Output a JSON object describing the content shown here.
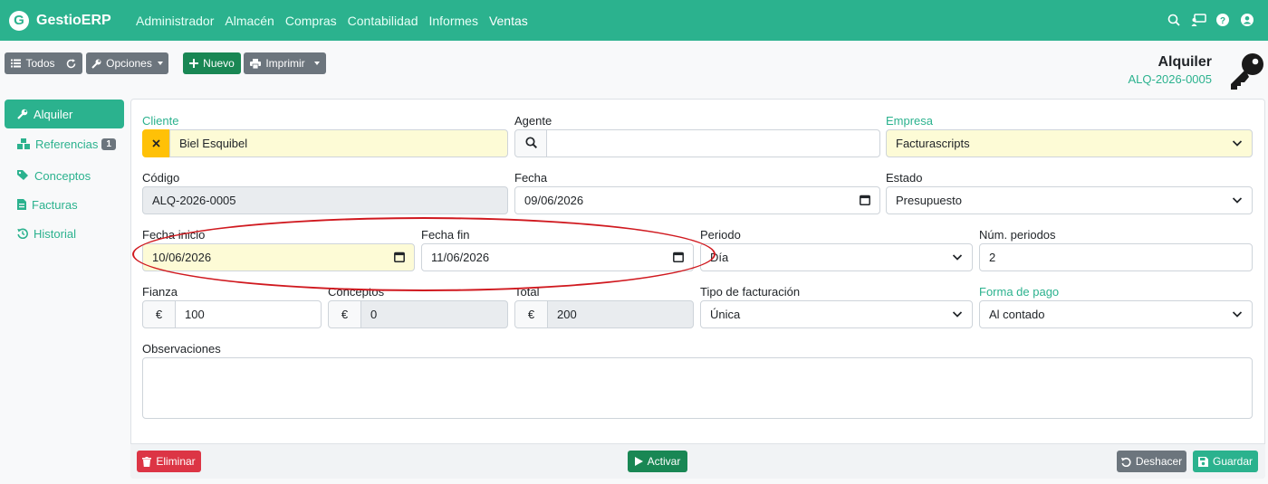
{
  "navbar": {
    "brand_letter": "G",
    "brand_name": "GestioERP",
    "menu": [
      "Administrador",
      "Almacén",
      "Compras",
      "Contabilidad",
      "Informes",
      "Ventas"
    ],
    "active": "Ventas"
  },
  "toolbar": {
    "all_label": "Todos",
    "options_label": "Opciones",
    "new_label": "Nuevo",
    "print_label": "Imprimir"
  },
  "header": {
    "title": "Alquiler",
    "code": "ALQ-2026-0005"
  },
  "sidebar": {
    "items": [
      {
        "label": "Alquiler",
        "icon": "wrench-icon",
        "active": true
      },
      {
        "label": "Referencias",
        "icon": "cubes-icon",
        "badge": "1"
      },
      {
        "label": "Conceptos",
        "icon": "tags-icon"
      },
      {
        "label": "Facturas",
        "icon": "file-invoice-icon"
      },
      {
        "label": "Historial",
        "icon": "history-icon"
      }
    ]
  },
  "form": {
    "cliente": {
      "label": "Cliente",
      "value": "Biel Esquibel"
    },
    "agente": {
      "label": "Agente",
      "value": ""
    },
    "empresa": {
      "label": "Empresa",
      "value": "Facturascripts"
    },
    "codigo": {
      "label": "Código",
      "value": "ALQ-2026-0005"
    },
    "fecha": {
      "label": "Fecha",
      "value": "09/06/2026"
    },
    "estado": {
      "label": "Estado",
      "value": "Presupuesto"
    },
    "fecha_inicio": {
      "label": "Fecha inicio",
      "value": "10/06/2026"
    },
    "fecha_fin": {
      "label": "Fecha fin",
      "value": "11/06/2026"
    },
    "periodo": {
      "label": "Periodo",
      "value": "Día"
    },
    "num_periodos": {
      "label": "Núm. periodos",
      "value": "2"
    },
    "fianza": {
      "label": "Fianza",
      "value": "100"
    },
    "conceptos": {
      "label": "Conceptos",
      "value": "0"
    },
    "total": {
      "label": "Total",
      "value": "200"
    },
    "tipo_facturacion": {
      "label": "Tipo de facturación",
      "value": "Única"
    },
    "forma_pago": {
      "label": "Forma de pago",
      "value": "Al contado"
    },
    "observaciones": {
      "label": "Observaciones",
      "value": ""
    },
    "currency": "€"
  },
  "footer": {
    "delete_label": "Eliminar",
    "activate_label": "Activar",
    "undo_label": "Deshacer",
    "save_label": "Guardar"
  },
  "colors": {
    "brand": "#2bb28e",
    "highlight": "#d0191f",
    "required_bg": "#fdfbd6"
  }
}
